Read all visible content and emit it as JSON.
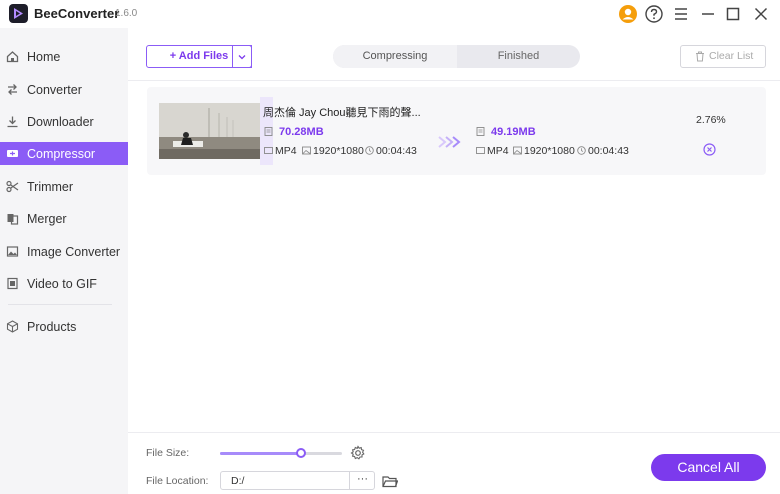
{
  "app": {
    "name": "BeeConverter",
    "version": "1.6.0"
  },
  "titlebar": {
    "icons": [
      "user-icon",
      "help-icon",
      "menu-icon",
      "minimize-icon",
      "maximize-icon",
      "close-icon"
    ]
  },
  "sidebar": {
    "items": [
      {
        "label": "Home",
        "icon": "home-icon"
      },
      {
        "label": "Converter",
        "icon": "convert-icon"
      },
      {
        "label": "Downloader",
        "icon": "download-icon"
      },
      {
        "label": "Compressor",
        "icon": "compress-icon",
        "active": true
      },
      {
        "label": "Trimmer",
        "icon": "scissors-icon"
      },
      {
        "label": "Merger",
        "icon": "merge-icon"
      },
      {
        "label": "Image Converter",
        "icon": "image-icon"
      },
      {
        "label": "Video to GIF",
        "icon": "gif-icon"
      },
      {
        "label": "Products",
        "icon": "cube-icon"
      }
    ]
  },
  "toolbar": {
    "add_files_label": "+ Add Files",
    "tabs": [
      "Compressing",
      "Finished"
    ],
    "clear_list_label": "Clear List"
  },
  "file": {
    "title": "周杰倫 Jay Chou聽見下雨的聲...",
    "source": {
      "size": "70.28MB",
      "format": "MP4",
      "resolution": "1920*1080",
      "duration": "00:04:43"
    },
    "output": {
      "size": "49.19MB",
      "format": "MP4",
      "resolution": "1920*1080",
      "duration": "00:04:43"
    },
    "progress_text": "2.76%"
  },
  "bottom": {
    "file_size_label": "File Size:",
    "file_size_slider": 0.66,
    "file_location_label": "File Location:",
    "file_location_value": "D:/",
    "browse_label": "···",
    "cancel_all_label": "Cancel All"
  },
  "colors": {
    "accent": "#8b5cf6",
    "accent_dark": "#7c3aed",
    "sidebar_bg": "#f5f5f7"
  }
}
